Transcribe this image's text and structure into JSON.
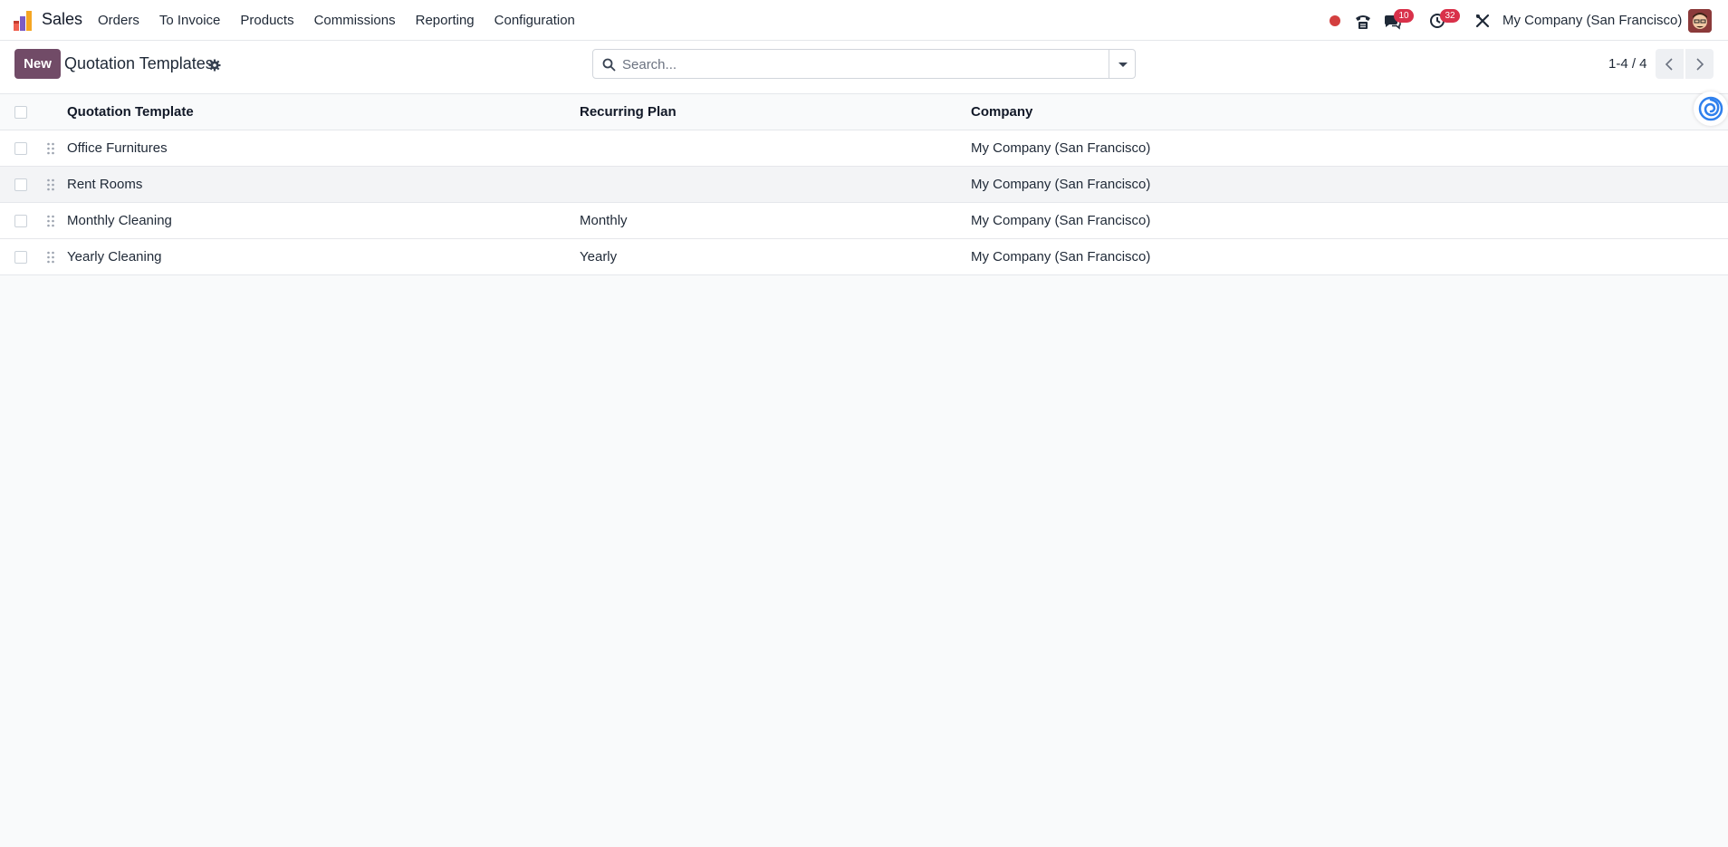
{
  "navbar": {
    "app_name": "Sales",
    "menu": [
      "Orders",
      "To Invoice",
      "Products",
      "Commissions",
      "Reporting",
      "Configuration"
    ],
    "messages_count": "10",
    "activities_count": "32",
    "company": "My Company (San Francisco)",
    "icons": [
      "recording-dot-icon",
      "phone-icon",
      "chat-icon",
      "clock-icon",
      "tools-icon"
    ]
  },
  "control_panel": {
    "new_label": "New",
    "title": "Quotation Templates",
    "search_placeholder": "Search...",
    "pager": "1-4 / 4"
  },
  "table": {
    "columns": [
      "Quotation Template",
      "Recurring Plan",
      "Company"
    ],
    "rows": [
      {
        "template": "Office Furnitures",
        "plan": "",
        "company": "My Company (San Francisco)"
      },
      {
        "template": "Rent Rooms",
        "plan": "",
        "company": "My Company (San Francisco)"
      },
      {
        "template": "Monthly Cleaning",
        "plan": "Monthly",
        "company": "My Company (San Francisco)"
      },
      {
        "template": "Yearly Cleaning",
        "plan": "Yearly",
        "company": "My Company (San Francisco)"
      }
    ]
  },
  "colors": {
    "brand": "#714b67",
    "badge": "#d9314a",
    "record": "#d33f3f"
  }
}
